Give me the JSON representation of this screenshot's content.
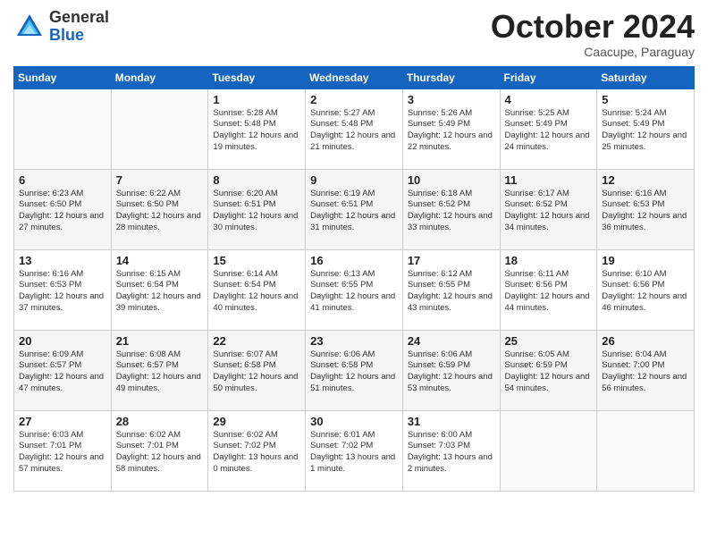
{
  "logo": {
    "general": "General",
    "blue": "Blue"
  },
  "title": "October 2024",
  "location": "Caacupe, Paraguay",
  "days_of_week": [
    "Sunday",
    "Monday",
    "Tuesday",
    "Wednesday",
    "Thursday",
    "Friday",
    "Saturday"
  ],
  "weeks": [
    [
      {
        "day": "",
        "empty": true
      },
      {
        "day": "",
        "empty": true
      },
      {
        "day": "1",
        "sunrise": "Sunrise: 5:28 AM",
        "sunset": "Sunset: 5:48 PM",
        "daylight": "Daylight: 12 hours and 19 minutes."
      },
      {
        "day": "2",
        "sunrise": "Sunrise: 5:27 AM",
        "sunset": "Sunset: 5:48 PM",
        "daylight": "Daylight: 12 hours and 21 minutes."
      },
      {
        "day": "3",
        "sunrise": "Sunrise: 5:26 AM",
        "sunset": "Sunset: 5:49 PM",
        "daylight": "Daylight: 12 hours and 22 minutes."
      },
      {
        "day": "4",
        "sunrise": "Sunrise: 5:25 AM",
        "sunset": "Sunset: 5:49 PM",
        "daylight": "Daylight: 12 hours and 24 minutes."
      },
      {
        "day": "5",
        "sunrise": "Sunrise: 5:24 AM",
        "sunset": "Sunset: 5:49 PM",
        "daylight": "Daylight: 12 hours and 25 minutes."
      }
    ],
    [
      {
        "day": "6",
        "sunrise": "Sunrise: 6:23 AM",
        "sunset": "Sunset: 6:50 PM",
        "daylight": "Daylight: 12 hours and 27 minutes."
      },
      {
        "day": "7",
        "sunrise": "Sunrise: 6:22 AM",
        "sunset": "Sunset: 6:50 PM",
        "daylight": "Daylight: 12 hours and 28 minutes."
      },
      {
        "day": "8",
        "sunrise": "Sunrise: 6:20 AM",
        "sunset": "Sunset: 6:51 PM",
        "daylight": "Daylight: 12 hours and 30 minutes."
      },
      {
        "day": "9",
        "sunrise": "Sunrise: 6:19 AM",
        "sunset": "Sunset: 6:51 PM",
        "daylight": "Daylight: 12 hours and 31 minutes."
      },
      {
        "day": "10",
        "sunrise": "Sunrise: 6:18 AM",
        "sunset": "Sunset: 6:52 PM",
        "daylight": "Daylight: 12 hours and 33 minutes."
      },
      {
        "day": "11",
        "sunrise": "Sunrise: 6:17 AM",
        "sunset": "Sunset: 6:52 PM",
        "daylight": "Daylight: 12 hours and 34 minutes."
      },
      {
        "day": "12",
        "sunrise": "Sunrise: 6:16 AM",
        "sunset": "Sunset: 6:53 PM",
        "daylight": "Daylight: 12 hours and 36 minutes."
      }
    ],
    [
      {
        "day": "13",
        "sunrise": "Sunrise: 6:16 AM",
        "sunset": "Sunset: 6:53 PM",
        "daylight": "Daylight: 12 hours and 37 minutes."
      },
      {
        "day": "14",
        "sunrise": "Sunrise: 6:15 AM",
        "sunset": "Sunset: 6:54 PM",
        "daylight": "Daylight: 12 hours and 39 minutes."
      },
      {
        "day": "15",
        "sunrise": "Sunrise: 6:14 AM",
        "sunset": "Sunset: 6:54 PM",
        "daylight": "Daylight: 12 hours and 40 minutes."
      },
      {
        "day": "16",
        "sunrise": "Sunrise: 6:13 AM",
        "sunset": "Sunset: 6:55 PM",
        "daylight": "Daylight: 12 hours and 41 minutes."
      },
      {
        "day": "17",
        "sunrise": "Sunrise: 6:12 AM",
        "sunset": "Sunset: 6:55 PM",
        "daylight": "Daylight: 12 hours and 43 minutes."
      },
      {
        "day": "18",
        "sunrise": "Sunrise: 6:11 AM",
        "sunset": "Sunset: 6:56 PM",
        "daylight": "Daylight: 12 hours and 44 minutes."
      },
      {
        "day": "19",
        "sunrise": "Sunrise: 6:10 AM",
        "sunset": "Sunset: 6:56 PM",
        "daylight": "Daylight: 12 hours and 46 minutes."
      }
    ],
    [
      {
        "day": "20",
        "sunrise": "Sunrise: 6:09 AM",
        "sunset": "Sunset: 6:57 PM",
        "daylight": "Daylight: 12 hours and 47 minutes."
      },
      {
        "day": "21",
        "sunrise": "Sunrise: 6:08 AM",
        "sunset": "Sunset: 6:57 PM",
        "daylight": "Daylight: 12 hours and 49 minutes."
      },
      {
        "day": "22",
        "sunrise": "Sunrise: 6:07 AM",
        "sunset": "Sunset: 6:58 PM",
        "daylight": "Daylight: 12 hours and 50 minutes."
      },
      {
        "day": "23",
        "sunrise": "Sunrise: 6:06 AM",
        "sunset": "Sunset: 6:58 PM",
        "daylight": "Daylight: 12 hours and 51 minutes."
      },
      {
        "day": "24",
        "sunrise": "Sunrise: 6:06 AM",
        "sunset": "Sunset: 6:59 PM",
        "daylight": "Daylight: 12 hours and 53 minutes."
      },
      {
        "day": "25",
        "sunrise": "Sunrise: 6:05 AM",
        "sunset": "Sunset: 6:59 PM",
        "daylight": "Daylight: 12 hours and 54 minutes."
      },
      {
        "day": "26",
        "sunrise": "Sunrise: 6:04 AM",
        "sunset": "Sunset: 7:00 PM",
        "daylight": "Daylight: 12 hours and 56 minutes."
      }
    ],
    [
      {
        "day": "27",
        "sunrise": "Sunrise: 6:03 AM",
        "sunset": "Sunset: 7:01 PM",
        "daylight": "Daylight: 12 hours and 57 minutes."
      },
      {
        "day": "28",
        "sunrise": "Sunrise: 6:02 AM",
        "sunset": "Sunset: 7:01 PM",
        "daylight": "Daylight: 12 hours and 58 minutes."
      },
      {
        "day": "29",
        "sunrise": "Sunrise: 6:02 AM",
        "sunset": "Sunset: 7:02 PM",
        "daylight": "Daylight: 13 hours and 0 minutes."
      },
      {
        "day": "30",
        "sunrise": "Sunrise: 6:01 AM",
        "sunset": "Sunset: 7:02 PM",
        "daylight": "Daylight: 13 hours and 1 minute."
      },
      {
        "day": "31",
        "sunrise": "Sunrise: 6:00 AM",
        "sunset": "Sunset: 7:03 PM",
        "daylight": "Daylight: 13 hours and 2 minutes."
      },
      {
        "day": "",
        "empty": true
      },
      {
        "day": "",
        "empty": true
      }
    ]
  ]
}
